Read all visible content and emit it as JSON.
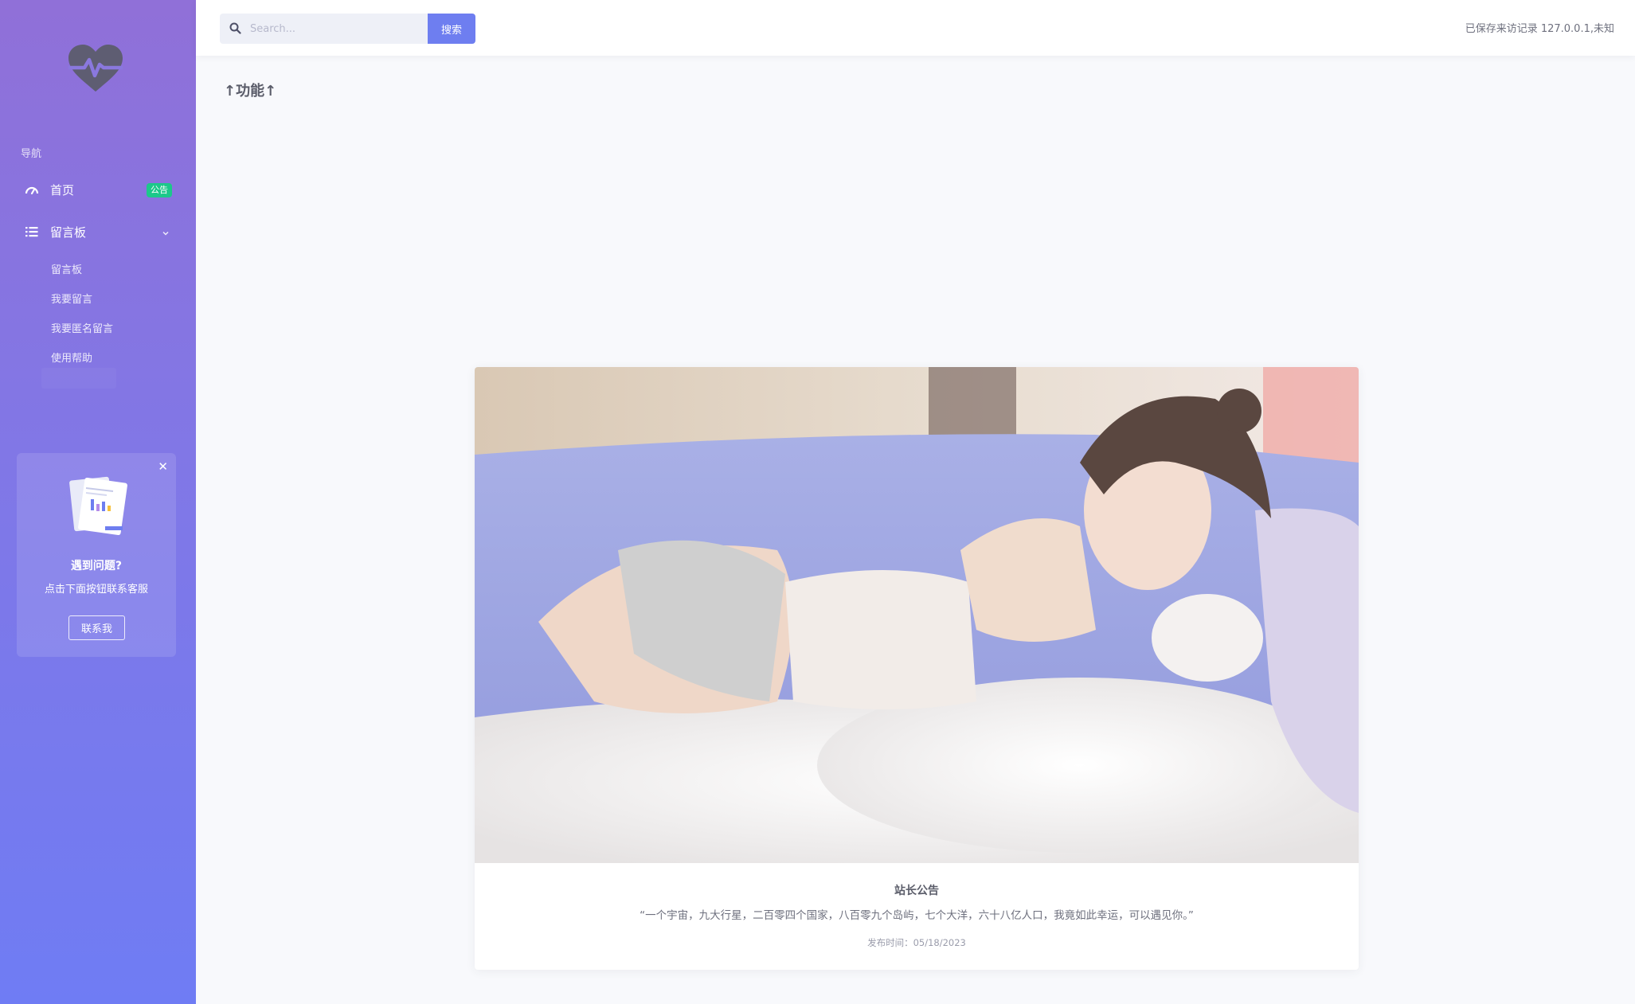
{
  "sidebar": {
    "logo_icon": "heartbeat-icon",
    "nav_heading": "导航",
    "home": {
      "label": "首页",
      "icon": "gauge-icon",
      "badge": "公告",
      "badge_color": "#1cc88a"
    },
    "board": {
      "label": "留言板",
      "icon": "list-icon",
      "expanded": true
    },
    "sub_items": [
      {
        "label": "留言板"
      },
      {
        "label": "我要留言"
      },
      {
        "label": "我要匿名留言"
      },
      {
        "label": "使用帮助"
      }
    ],
    "help_card": {
      "title": "遇到问题?",
      "subtitle": "点击下面按钮联系客服",
      "button": "联系我"
    }
  },
  "topbar": {
    "search": {
      "placeholder": "Search...",
      "button": "搜索"
    },
    "visit_record": "已保存来访记录 127.0.0.1,未知"
  },
  "main": {
    "page_title": "↑功能↑",
    "notice": {
      "title": "站长公告",
      "text": "“一个宇宙，九大行星，二百零四个国家，八百零九个岛屿，七个大洋，六十八亿人口，我竟如此幸运，可以遇见你。”",
      "date": "发布时间：05/18/2023"
    }
  },
  "colors": {
    "sidebar_top": "#9070d8",
    "sidebar_bottom": "#6f7cf4",
    "accent": "#6e7ef0",
    "background": "#f8f9fc"
  }
}
